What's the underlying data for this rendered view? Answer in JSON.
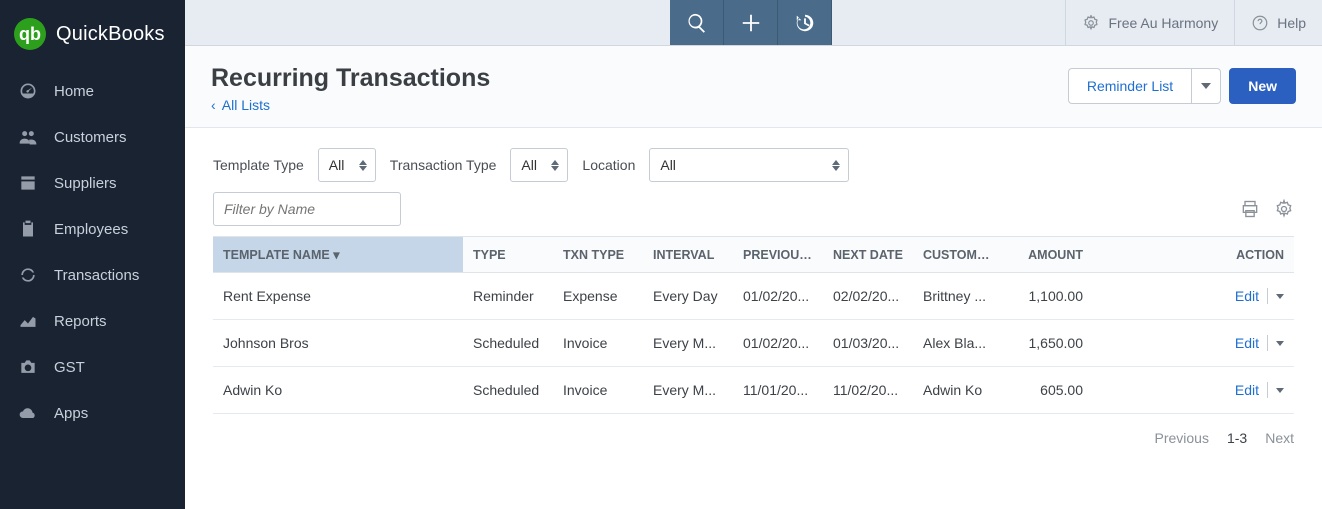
{
  "brand": {
    "name": "QuickBooks",
    "logo_letter": "qb"
  },
  "sidebar": {
    "items": [
      {
        "label": "Home"
      },
      {
        "label": "Customers"
      },
      {
        "label": "Suppliers"
      },
      {
        "label": "Employees"
      },
      {
        "label": "Transactions"
      },
      {
        "label": "Reports"
      },
      {
        "label": "GST"
      },
      {
        "label": "Apps"
      }
    ]
  },
  "topbar": {
    "harmony_label": "Free Au Harmony",
    "help_label": "Help"
  },
  "header": {
    "title": "Recurring Transactions",
    "breadcrumb_label": "All Lists",
    "reminder_btn": "Reminder List",
    "new_btn": "New"
  },
  "filters": {
    "template_type_label": "Template Type",
    "template_type_value": "All",
    "transaction_type_label": "Transaction Type",
    "transaction_type_value": "All",
    "location_label": "Location",
    "location_value": "All",
    "filter_placeholder": "Filter by Name"
  },
  "table": {
    "columns": {
      "name": "TEMPLATE NAME",
      "type": "TYPE",
      "txn_type": "TXN TYPE",
      "interval": "INTERVAL",
      "previous": "PREVIOUS DATE",
      "next": "NEXT DATE",
      "customer": "CUSTOMER",
      "amount": "AMOUNT",
      "action": "ACTION"
    },
    "rows": [
      {
        "name": "Rent Expense",
        "type": "Reminder",
        "txn_type": "Expense",
        "interval": "Every Day",
        "previous": "01/02/20...",
        "next": "02/02/20...",
        "customer": "Brittney ...",
        "amount": "1,100.00",
        "action": "Edit"
      },
      {
        "name": "Johnson Bros",
        "type": "Scheduled",
        "txn_type": "Invoice",
        "interval": "Every M...",
        "previous": "01/02/20...",
        "next": "01/03/20...",
        "customer": "Alex Bla...",
        "amount": "1,650.00",
        "action": "Edit"
      },
      {
        "name": "Adwin Ko",
        "type": "Scheduled",
        "txn_type": "Invoice",
        "interval": "Every M...",
        "previous": "11/01/20...",
        "next": "11/02/20...",
        "customer": "Adwin Ko",
        "amount": "605.00",
        "action": "Edit"
      }
    ]
  },
  "pagination": {
    "prev": "Previous",
    "range": "1-3",
    "next": "Next"
  }
}
